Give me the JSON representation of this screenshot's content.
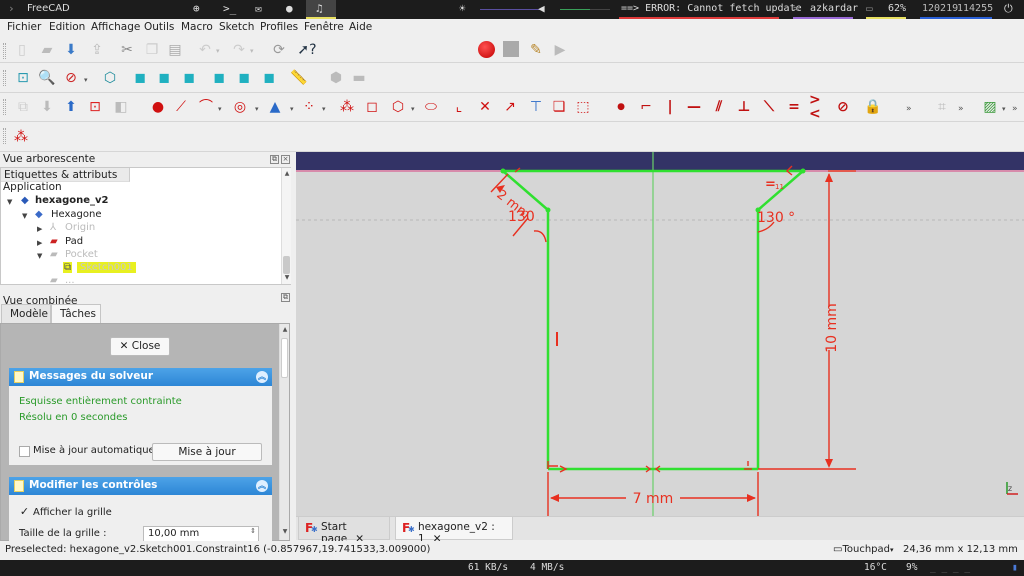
{
  "topbar": {
    "app_name": "FreeCAD",
    "error_text": "==> ERROR: Cannot fetch update",
    "wifi_name": "azkardar",
    "battery": "62%",
    "net_a": "120219",
    "net_b": "114255",
    "icons": [
      "launcher-icon",
      "terminal-icon",
      "mail-icon",
      "chat-icon",
      "headphones-icon",
      "brightness-icon",
      "volume-icon",
      "wifi-icon",
      "battery-icon",
      "power-icon"
    ],
    "brightness_level": 0.45,
    "volume_level": 0.6
  },
  "menu": [
    "Fichier",
    "Edition",
    "Affichage",
    "Outils",
    "Macro",
    "Sketch",
    "Profiles",
    "Fenêtre",
    "Aide"
  ],
  "toolbar": {
    "workbench": "Sketcher",
    "workbench_icon": "sketcher-icon"
  },
  "tree_panel": {
    "title": "Vue arborescente",
    "column_header": "Etiquettes & attributs",
    "root": "Application",
    "items": [
      {
        "label": "hexagone_v2",
        "level": 1,
        "expanded": true,
        "bold": true
      },
      {
        "label": "Hexagone",
        "level": 2,
        "expanded": true
      },
      {
        "label": "Origin",
        "level": 3,
        "expanded": false,
        "dim": true
      },
      {
        "label": "Pad",
        "level": 3,
        "expanded": false
      },
      {
        "label": "Pocket",
        "level": 3,
        "expanded": true,
        "dim": true
      },
      {
        "label": "Sketch001",
        "level": 4,
        "selected": true
      },
      {
        "label": "...",
        "level": 3,
        "dim": true
      }
    ]
  },
  "combo_panel": {
    "title": "Vue combinée",
    "tabs": [
      "Modèle",
      "Tâches"
    ],
    "active_tab": "Tâches",
    "close_label": "Close",
    "solver": {
      "title": "Messages du solveur",
      "line1": "Esquisse entièrement contrainte",
      "line2": "Résolu en 0 secondes",
      "auto_update_label": "Mise à jour automatique",
      "auto_update_checked": false,
      "update_button": "Mise à jour"
    },
    "controls": {
      "title": "Modifier les contrôles",
      "show_grid_label": "Afficher la grille",
      "show_grid_checked": true,
      "grid_size_label": "Taille de la grille :",
      "grid_size_value": "10,00 mm"
    }
  },
  "sketch": {
    "dimensions": {
      "height": "10 mm",
      "width": "7 mm",
      "angle_left": "130",
      "angle_right": "130 °",
      "chamfer": "2 mm",
      "equal_right": "=",
      "equal_sub": "11"
    }
  },
  "doc_tabs": [
    {
      "label": "Start page",
      "active": false
    },
    {
      "label": "hexagone_v2 : 1",
      "active": true
    }
  ],
  "status": {
    "preselected": "Preselected: hexagone_v2.Sketch001.Constraint16 (-0.857967,19.741533,3.009000)",
    "nav_style": "Touchpad",
    "dimensions": "24,36 mm x 12,13 mm"
  },
  "bottombar": {
    "down": "61 KB/s",
    "up": "4 MB/s",
    "temp": "16°C",
    "cpu": "9%"
  }
}
